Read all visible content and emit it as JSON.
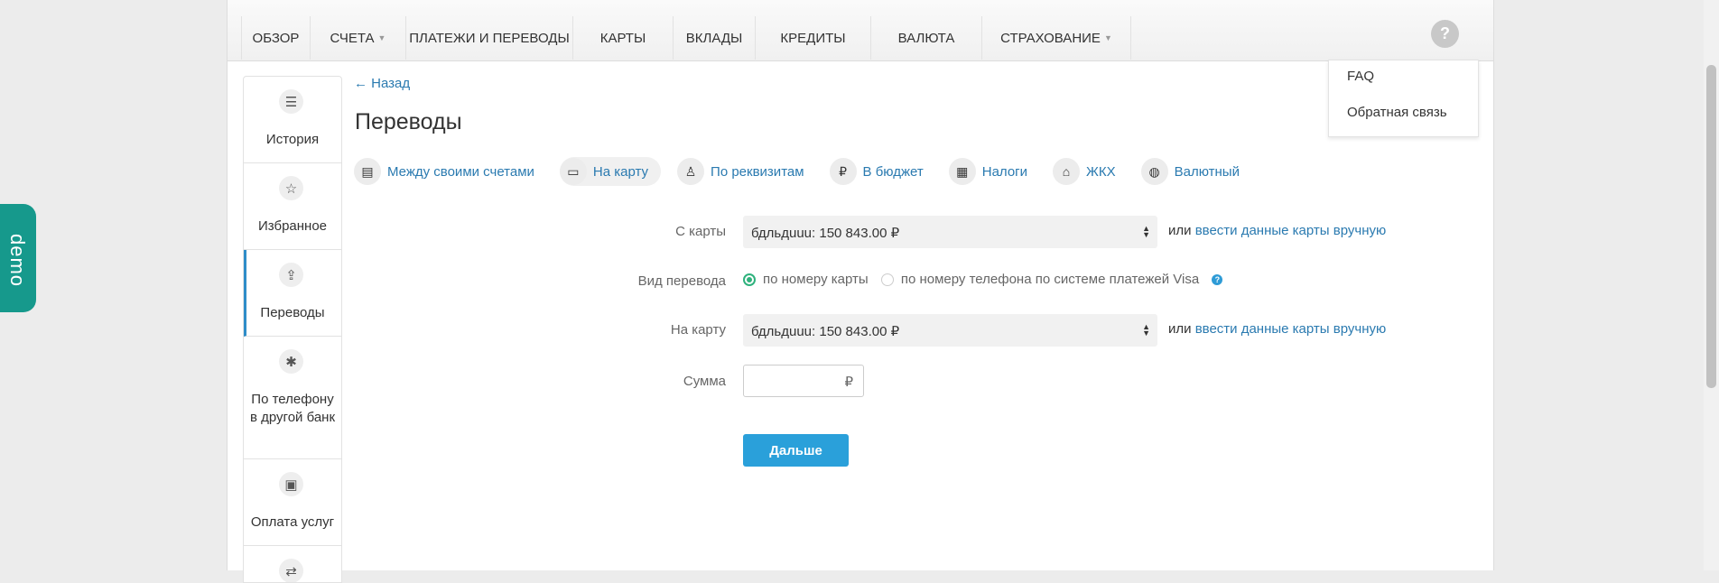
{
  "nav": {
    "items": [
      {
        "label": "ОБЗОР",
        "dropdown": false
      },
      {
        "label": "СЧЕТА",
        "dropdown": true
      },
      {
        "label": "ПЛАТЕЖИ И ПЕРЕВОДЫ",
        "dropdown": false
      },
      {
        "label": "КАРТЫ",
        "dropdown": false
      },
      {
        "label": "ВКЛАДЫ",
        "dropdown": false
      },
      {
        "label": "КРЕДИТЫ",
        "dropdown": false
      },
      {
        "label": "ВАЛЮТА",
        "dropdown": false
      },
      {
        "label": "СТРАХОВАНИЕ",
        "dropdown": true
      }
    ],
    "help_label": "?"
  },
  "help_menu": {
    "items": [
      "FAQ",
      "Обратная связь"
    ]
  },
  "sidebar": {
    "items": [
      {
        "label": "История",
        "icon": "list-icon"
      },
      {
        "label": "Избранное",
        "icon": "star-icon"
      },
      {
        "label": "Переводы",
        "icon": "transfer-icon",
        "active": true
      },
      {
        "label": "По телефону в другой банк",
        "icon": "phone-transfer-icon"
      },
      {
        "label": "Оплата услуг",
        "icon": "wallet-icon"
      }
    ]
  },
  "main": {
    "back_label": "← Назад",
    "title": "Переводы",
    "tabs": [
      {
        "label": "Между своими счетами",
        "icon": "accounts-icon",
        "active": false
      },
      {
        "label": "На карту",
        "icon": "card-icon",
        "active": true
      },
      {
        "label": "По реквизитам",
        "icon": "person-icon",
        "active": false
      },
      {
        "label": "В бюджет",
        "icon": "budget-icon",
        "active": false
      },
      {
        "label": "Налоги",
        "icon": "tax-icon",
        "active": false
      },
      {
        "label": "ЖКХ",
        "icon": "house-icon",
        "active": false
      },
      {
        "label": "Валютный",
        "icon": "globe-icon",
        "active": false
      }
    ]
  },
  "form": {
    "from_label": "С карты",
    "from_value": "бдльдuuu: 150 843.00 ₽",
    "or_text": "или",
    "manual_link": "ввести данные карты вручную",
    "type_label": "Вид перевода",
    "type_option1": "по номеру карты",
    "type_option2": "по номеру телефона по системе платежей Visa",
    "to_label": "На карту",
    "to_value": "бдльдuuu: 150 843.00 ₽",
    "amount_label": "Сумма",
    "currency": "₽",
    "submit_label": "Дальше"
  },
  "demo_label": "demo",
  "colors": {
    "accent": "#2aa0da",
    "link": "#2a7ab0",
    "demo": "#16998c",
    "radio": "#2fb27d"
  }
}
